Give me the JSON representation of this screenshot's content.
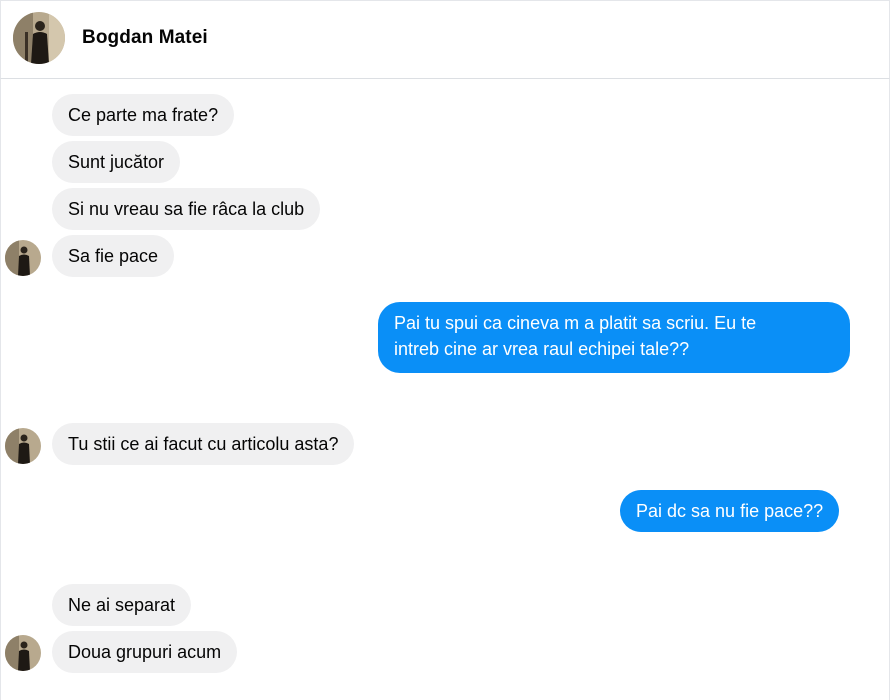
{
  "header": {
    "contact_name": "Bogdan Matei"
  },
  "messages": [
    {
      "from": "contact",
      "text": "Ce parte ma frate?"
    },
    {
      "from": "contact",
      "text": "Sunt jucător"
    },
    {
      "from": "contact",
      "text": "Si nu vreau sa fie râca la club"
    },
    {
      "from": "contact",
      "text": "Sa fie pace"
    },
    {
      "from": "me",
      "lines": [
        "Pai tu spui ca cineva m a platit sa scriu. Eu te",
        "intreb cine ar vrea raul echipei tale??"
      ]
    },
    {
      "from": "contact",
      "text": "Tu stii ce ai facut cu articolu asta?"
    },
    {
      "from": "me",
      "text": "Pai dc sa nu fie pace??"
    },
    {
      "from": "contact",
      "text": "Ne ai separat"
    },
    {
      "from": "contact",
      "text": "Doua grupuri acum"
    }
  ],
  "colors": {
    "outgoing_bubble": "#0a8ff7",
    "incoming_bubble": "#f0f0f1"
  }
}
